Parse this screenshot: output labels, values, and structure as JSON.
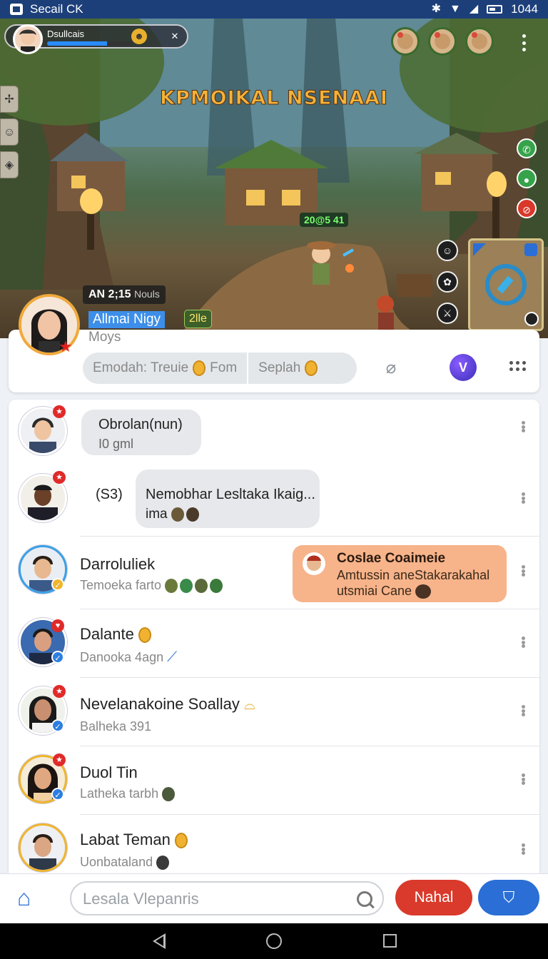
{
  "status_bar": {
    "title": "Secail CK",
    "time": "1044"
  },
  "game": {
    "title": "KPMOIKAL NSENAAI",
    "player_name": "Dsullcais",
    "player_hp_fraction": 0.7,
    "score_tag": "20@5 41",
    "time_label": "AN 2;15",
    "time_note": "Nouls"
  },
  "profile": {
    "name": "Allmai Nigy",
    "subtitle": "Moys",
    "level": "2lle",
    "pill_1": "Emodah: Treuie",
    "pill_2": "Fom",
    "pill_3": "Seplah"
  },
  "chats": [
    {
      "bubble_title": "Obrolan(nun)",
      "bubble_sub": "I0 gml"
    },
    {
      "prefix": "(S3)",
      "bubble_title": "Nemobhar Lesltaka Ikaig...",
      "bubble_sub": "ima"
    },
    {
      "name": "Darroluliek",
      "sub": "Temoeka farto",
      "card_title": "Coslae Coaimeie",
      "card_line1": "Amtussin aneStakarakahal",
      "card_line2": "utsmiai Cane"
    },
    {
      "name": "Dalante",
      "sub": "Danooka 4agn"
    },
    {
      "name": "Nevelanakoine Soallay",
      "sub": "Balheka 391"
    },
    {
      "name": "Duol Tin",
      "sub": "Latheka tarbh"
    },
    {
      "name": "Labat Teman",
      "sub": "Uonbataland"
    }
  ],
  "bottom": {
    "search_placeholder": "Lesala Vlepanris",
    "primary_button": "Nahal"
  },
  "colors": {
    "status_bar": "#1c3f7a",
    "accent_blue": "#2a6ed6",
    "accent_red": "#d93a2b",
    "card_orange": "#f7b38a"
  },
  "icons": [
    "app-icon",
    "bluetooth-icon",
    "wifi-icon",
    "signal-icon",
    "battery-icon",
    "home-icon",
    "search-icon",
    "shield-icon",
    "microphone-icon",
    "gem-icon",
    "more-icon",
    "back-icon",
    "recents-icon"
  ]
}
